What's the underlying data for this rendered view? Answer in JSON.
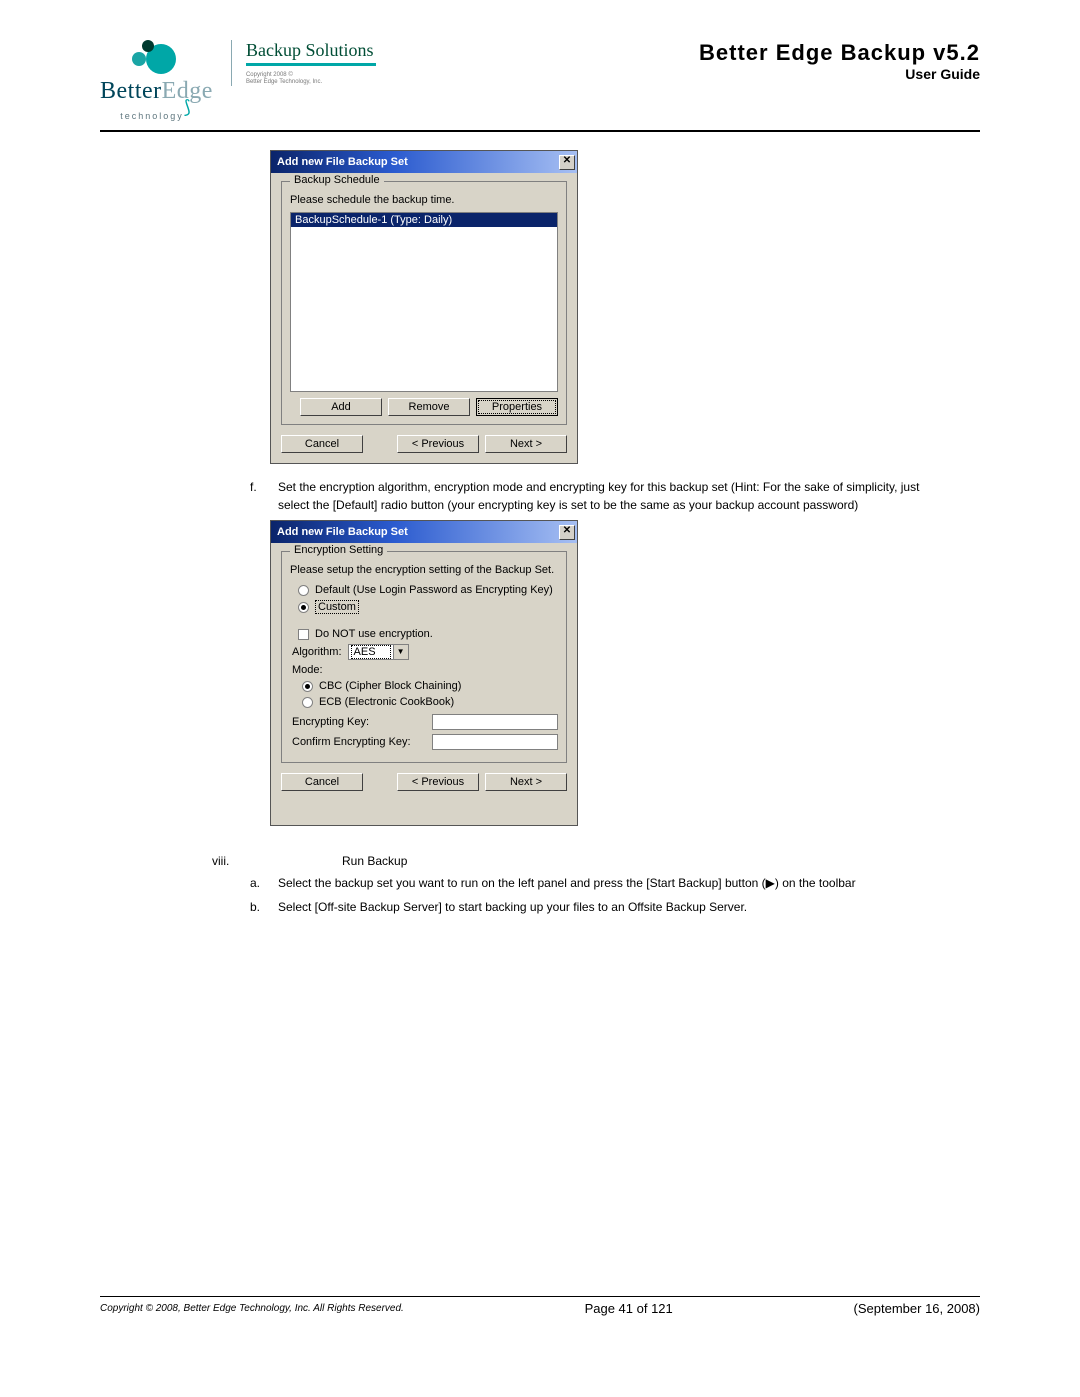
{
  "header": {
    "brand_main": "BetterEdge",
    "brand_tag": "technology",
    "backup_solutions": "Backup Solutions",
    "tiny_copy_1": "Copyright 2008 ©",
    "tiny_copy_2": "Better Edge Technology, Inc.",
    "product_title": "Better Edge Backup v5.2",
    "user_guide": "User Guide"
  },
  "dialog1": {
    "title": "Add new File Backup Set",
    "close_glyph": "✕",
    "legend": "Backup Schedule",
    "instruct": "Please schedule the backup time.",
    "selected_row": "BackupSchedule-1 (Type: Daily)",
    "btn_add": "Add",
    "btn_remove": "Remove",
    "btn_properties": "Properties",
    "btn_cancel": "Cancel",
    "btn_prev": "< Previous",
    "btn_next": "Next >"
  },
  "step_f": {
    "marker": "f.",
    "text": "Set the encryption algorithm, encryption mode and encrypting key for this backup set (Hint: For the sake of simplicity, just select the [Default] radio button (your encrypting key is set to be the same as your backup account password)"
  },
  "dialog2": {
    "title": "Add new File Backup Set",
    "close_glyph": "✕",
    "legend": "Encryption Setting",
    "instruct": "Please setup the encryption setting of the Backup Set.",
    "radio_default": "Default (Use Login Password as Encrypting Key)",
    "radio_custom": "Custom",
    "check_no_enc": "Do NOT use encryption.",
    "algorithm_label": "Algorithm:",
    "algorithm_value": "AES",
    "mode_label": "Mode:",
    "mode_cbc": "CBC (Cipher Block Chaining)",
    "mode_ecb": "ECB (Electronic CookBook)",
    "enc_key_label": "Encrypting Key:",
    "confirm_key_label": "Confirm Encrypting Key:",
    "btn_cancel": "Cancel",
    "btn_prev": "< Previous",
    "btn_next": "Next >"
  },
  "section_viii": {
    "marker": "viii.",
    "title": "Run Backup"
  },
  "step_a": {
    "marker": "a.",
    "text": "Select the backup set you want to run on the left panel and press the [Start Backup] button (▶) on the toolbar"
  },
  "step_b": {
    "marker": "b.",
    "text": "Select [Off-site Backup Server] to start backing up your files to an Offsite Backup Server."
  },
  "footer": {
    "copyright": "Copyright © 2008, Better Edge Technology, Inc.   All Rights Reserved.",
    "page": "Page 41 of 121",
    "date": "(September 16, 2008)"
  }
}
